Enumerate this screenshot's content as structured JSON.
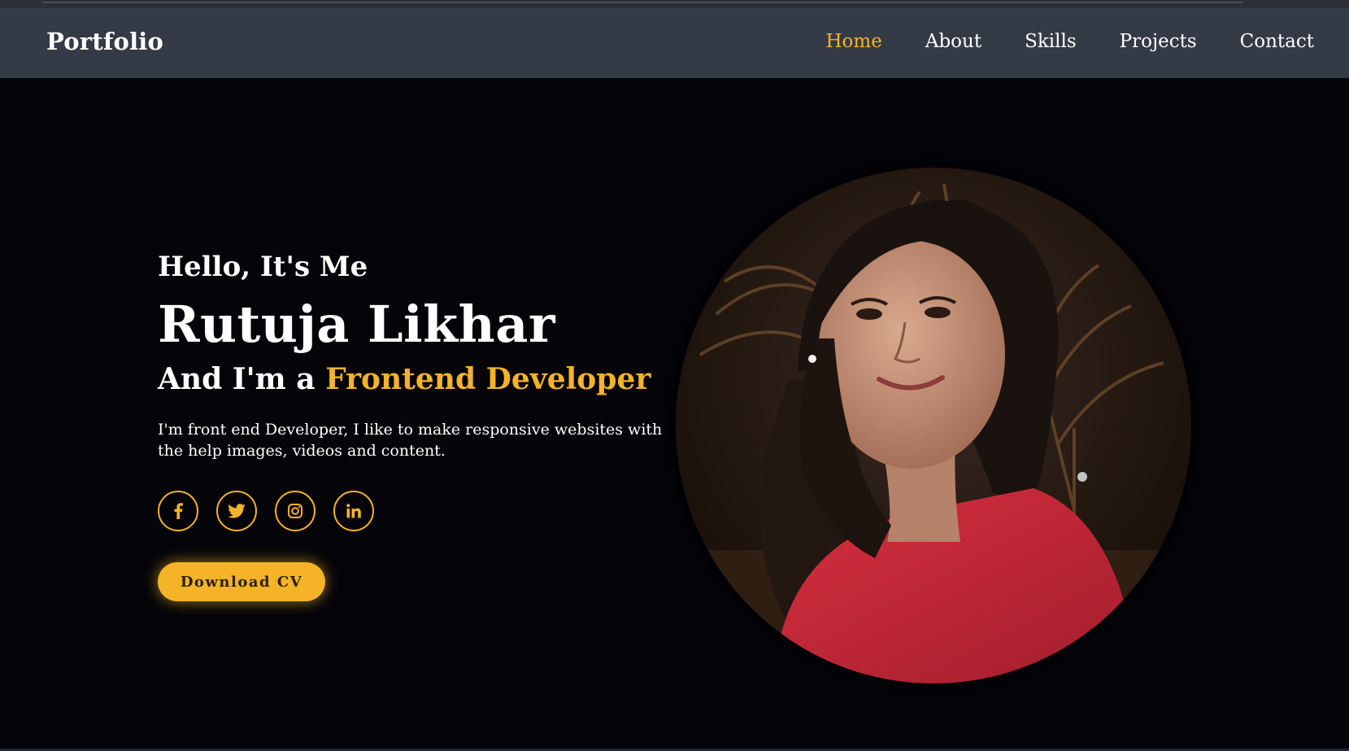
{
  "header": {
    "logo": "Portfolio",
    "nav": [
      {
        "label": "Home",
        "active": true
      },
      {
        "label": "About",
        "active": false
      },
      {
        "label": "Skills",
        "active": false
      },
      {
        "label": "Projects",
        "active": false
      },
      {
        "label": "Contact",
        "active": false
      }
    ]
  },
  "hero": {
    "greeting": "Hello, It's Me",
    "name": "Rutuja Likhar",
    "role_prefix": "And I'm a ",
    "role": "Frontend Developer",
    "description": "I'm front end Developer, I like to make responsive websites with the help images, videos and content.",
    "socials": [
      "facebook-icon",
      "twitter-icon",
      "instagram-icon",
      "linkedin-icon"
    ],
    "cta_label": "Download CV"
  },
  "colors": {
    "accent": "#f5b327",
    "header_bg": "#343a46",
    "page_bg": "#040409",
    "text": "#ffffff"
  }
}
